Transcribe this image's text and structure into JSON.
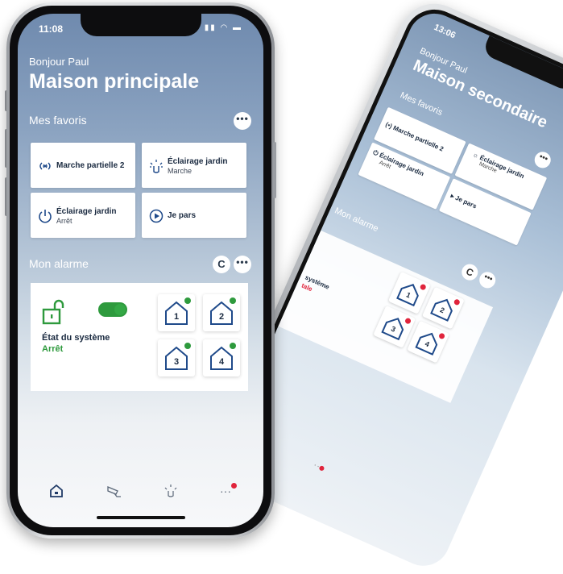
{
  "back_phone": {
    "time": "13:06",
    "greeting": "Bonjour Paul",
    "home_name": "Maison secondaire",
    "favorites_title": "Mes favoris",
    "favorites": [
      {
        "label": "Marche partielle 2",
        "sub": ""
      },
      {
        "label": "Éclairage jardin",
        "sub": "Marche"
      },
      {
        "label": "Éclairage jardin",
        "sub": "Arrêt"
      },
      {
        "label": "Je pars",
        "sub": ""
      }
    ],
    "alarm_title": "Mon alarme",
    "system_label": "système",
    "system_state": "tale",
    "zones": [
      "1",
      "2",
      "3",
      "4"
    ],
    "zone_dot_color": "#e0243c",
    "accent_color": "#e0243c"
  },
  "front_phone": {
    "time": "11:08",
    "greeting": "Bonjour Paul",
    "home_name": "Maison principale",
    "favorites_title": "Mes favoris",
    "more_label": "•••",
    "favorites": [
      {
        "label": "Marche partielle 2",
        "sub": "",
        "icon": "partial-arm-icon"
      },
      {
        "label": "Éclairage jardin",
        "sub": "Marche",
        "icon": "light-on-icon"
      },
      {
        "label": "Éclairage jardin",
        "sub": "Arrêt",
        "icon": "power-icon"
      },
      {
        "label": "Je pars",
        "sub": "",
        "icon": "play-circle-icon"
      }
    ],
    "alarm_title": "Mon alarme",
    "refresh_label": "C",
    "system_label": "État du système",
    "system_state": "Arrêt",
    "zones": [
      "1",
      "2",
      "3",
      "4"
    ],
    "zone_dot_color": "#2e9a3d",
    "accent_color": "#2e9a3d",
    "tabs": [
      {
        "name": "home-icon",
        "glyph": "⌂"
      },
      {
        "name": "camera-icon",
        "glyph": "⌁"
      },
      {
        "name": "light-icon",
        "glyph": "☼"
      },
      {
        "name": "more-icon",
        "glyph": "···"
      }
    ]
  }
}
